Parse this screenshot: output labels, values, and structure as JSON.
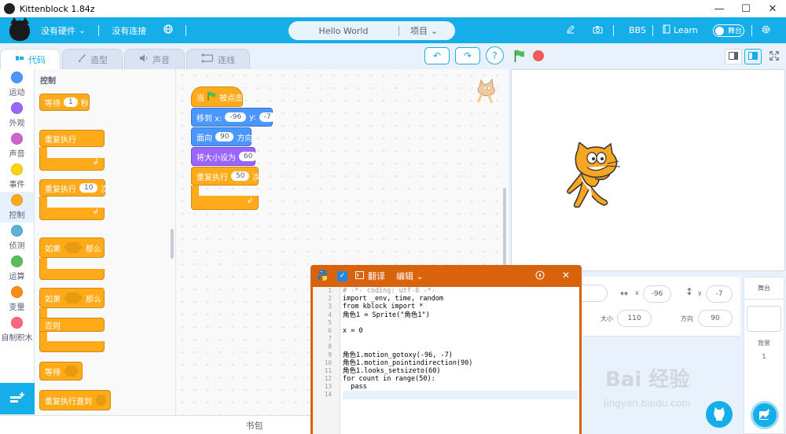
{
  "window": {
    "title": "Kittenblock 1.84z",
    "minimize": "—",
    "maximize": "☐",
    "close": "✕"
  },
  "menubar": {
    "hardware": "没有硬件",
    "connection": "没有连接",
    "project_name": "Hello World",
    "project_menu": "项目",
    "bbs": "BBS",
    "learn": "Learn",
    "stage_toggle": "舞台",
    "icons": [
      "pencil-icon",
      "camera-icon",
      "globe-icon",
      "book-icon",
      "gear-icon"
    ]
  },
  "tabs": [
    {
      "label": "代码",
      "icon": "code-icon",
      "active": true
    },
    {
      "label": "造型",
      "icon": "brush-icon",
      "active": false
    },
    {
      "label": "声音",
      "icon": "speaker-icon",
      "active": false
    },
    {
      "label": "连线",
      "icon": "wire-icon",
      "active": false
    }
  ],
  "categories": [
    {
      "label": "运动",
      "color": "#4c97ff"
    },
    {
      "label": "外观",
      "color": "#9966ff"
    },
    {
      "label": "声音",
      "color": "#cf63cf"
    },
    {
      "label": "事件",
      "color": "#ffd500"
    },
    {
      "label": "控制",
      "color": "#ffab19"
    },
    {
      "label": "侦测",
      "color": "#5cb1d6"
    },
    {
      "label": "运算",
      "color": "#59c059"
    },
    {
      "label": "变量",
      "color": "#ff8c1a"
    },
    {
      "label": "自制积木",
      "color": "#ff6680"
    }
  ],
  "palette": {
    "title": "控制",
    "wait": "等待",
    "wait_value": "1",
    "wait_unit": "秒",
    "forever": "重复执行",
    "repeat": "重复执行",
    "repeat_value": "10",
    "repeat_unit": "次",
    "if_then": "如果",
    "then": "那么",
    "if_else": "如果",
    "else_then": "那么",
    "else": "否则",
    "wait_until": "等待",
    "repeat_until": "重复执行直到"
  },
  "script": {
    "when": "当",
    "clicked": "被点击",
    "goto": "移到 x:",
    "goto_x": "-96",
    "goto_y_label": "y:",
    "goto_y": "-7",
    "point": "面向",
    "point_value": "90",
    "point_unit": "方向",
    "size": "将大小设为",
    "size_value": "60",
    "repeat": "重复执行",
    "repeat_value": "50",
    "repeat_unit": "次"
  },
  "controls": {
    "undo": "↶",
    "redo": "↷",
    "help": "?"
  },
  "python": {
    "translate": "翻译",
    "edit": "编辑",
    "line_numbers": [
      "1",
      "2",
      "3",
      "4",
      "5",
      "6",
      "7",
      "8",
      "9",
      "10",
      "11",
      "12",
      "13",
      "14"
    ],
    "code": [
      "# -*- coding: utf-8 -*-",
      "import _env, time, random",
      "from kblock import *",
      "角色1 = Sprite(\"角色1\")",
      "",
      "x = 0",
      "",
      "",
      "角色1.motion_gotoxy(-96, -7)",
      "角色1.motion_pointindirection(90)",
      "角色1.looks_setsizeto(60)",
      "for count in range(50):",
      "  pass",
      ""
    ]
  },
  "sprite_info": {
    "x_label": "x",
    "x_value": "-96",
    "y_label": "y",
    "y_value": "-7",
    "size_label": "大小",
    "size_value": "110",
    "direction_label": "方向",
    "direction_value": "90"
  },
  "stage_pane": {
    "title": "舞台",
    "backdrop_label": "背景",
    "backdrop_count": "1"
  },
  "footer": {
    "backpack": "书包"
  },
  "watermark": {
    "main": "Bai 经验",
    "url": "jingyan.baidu.com"
  }
}
